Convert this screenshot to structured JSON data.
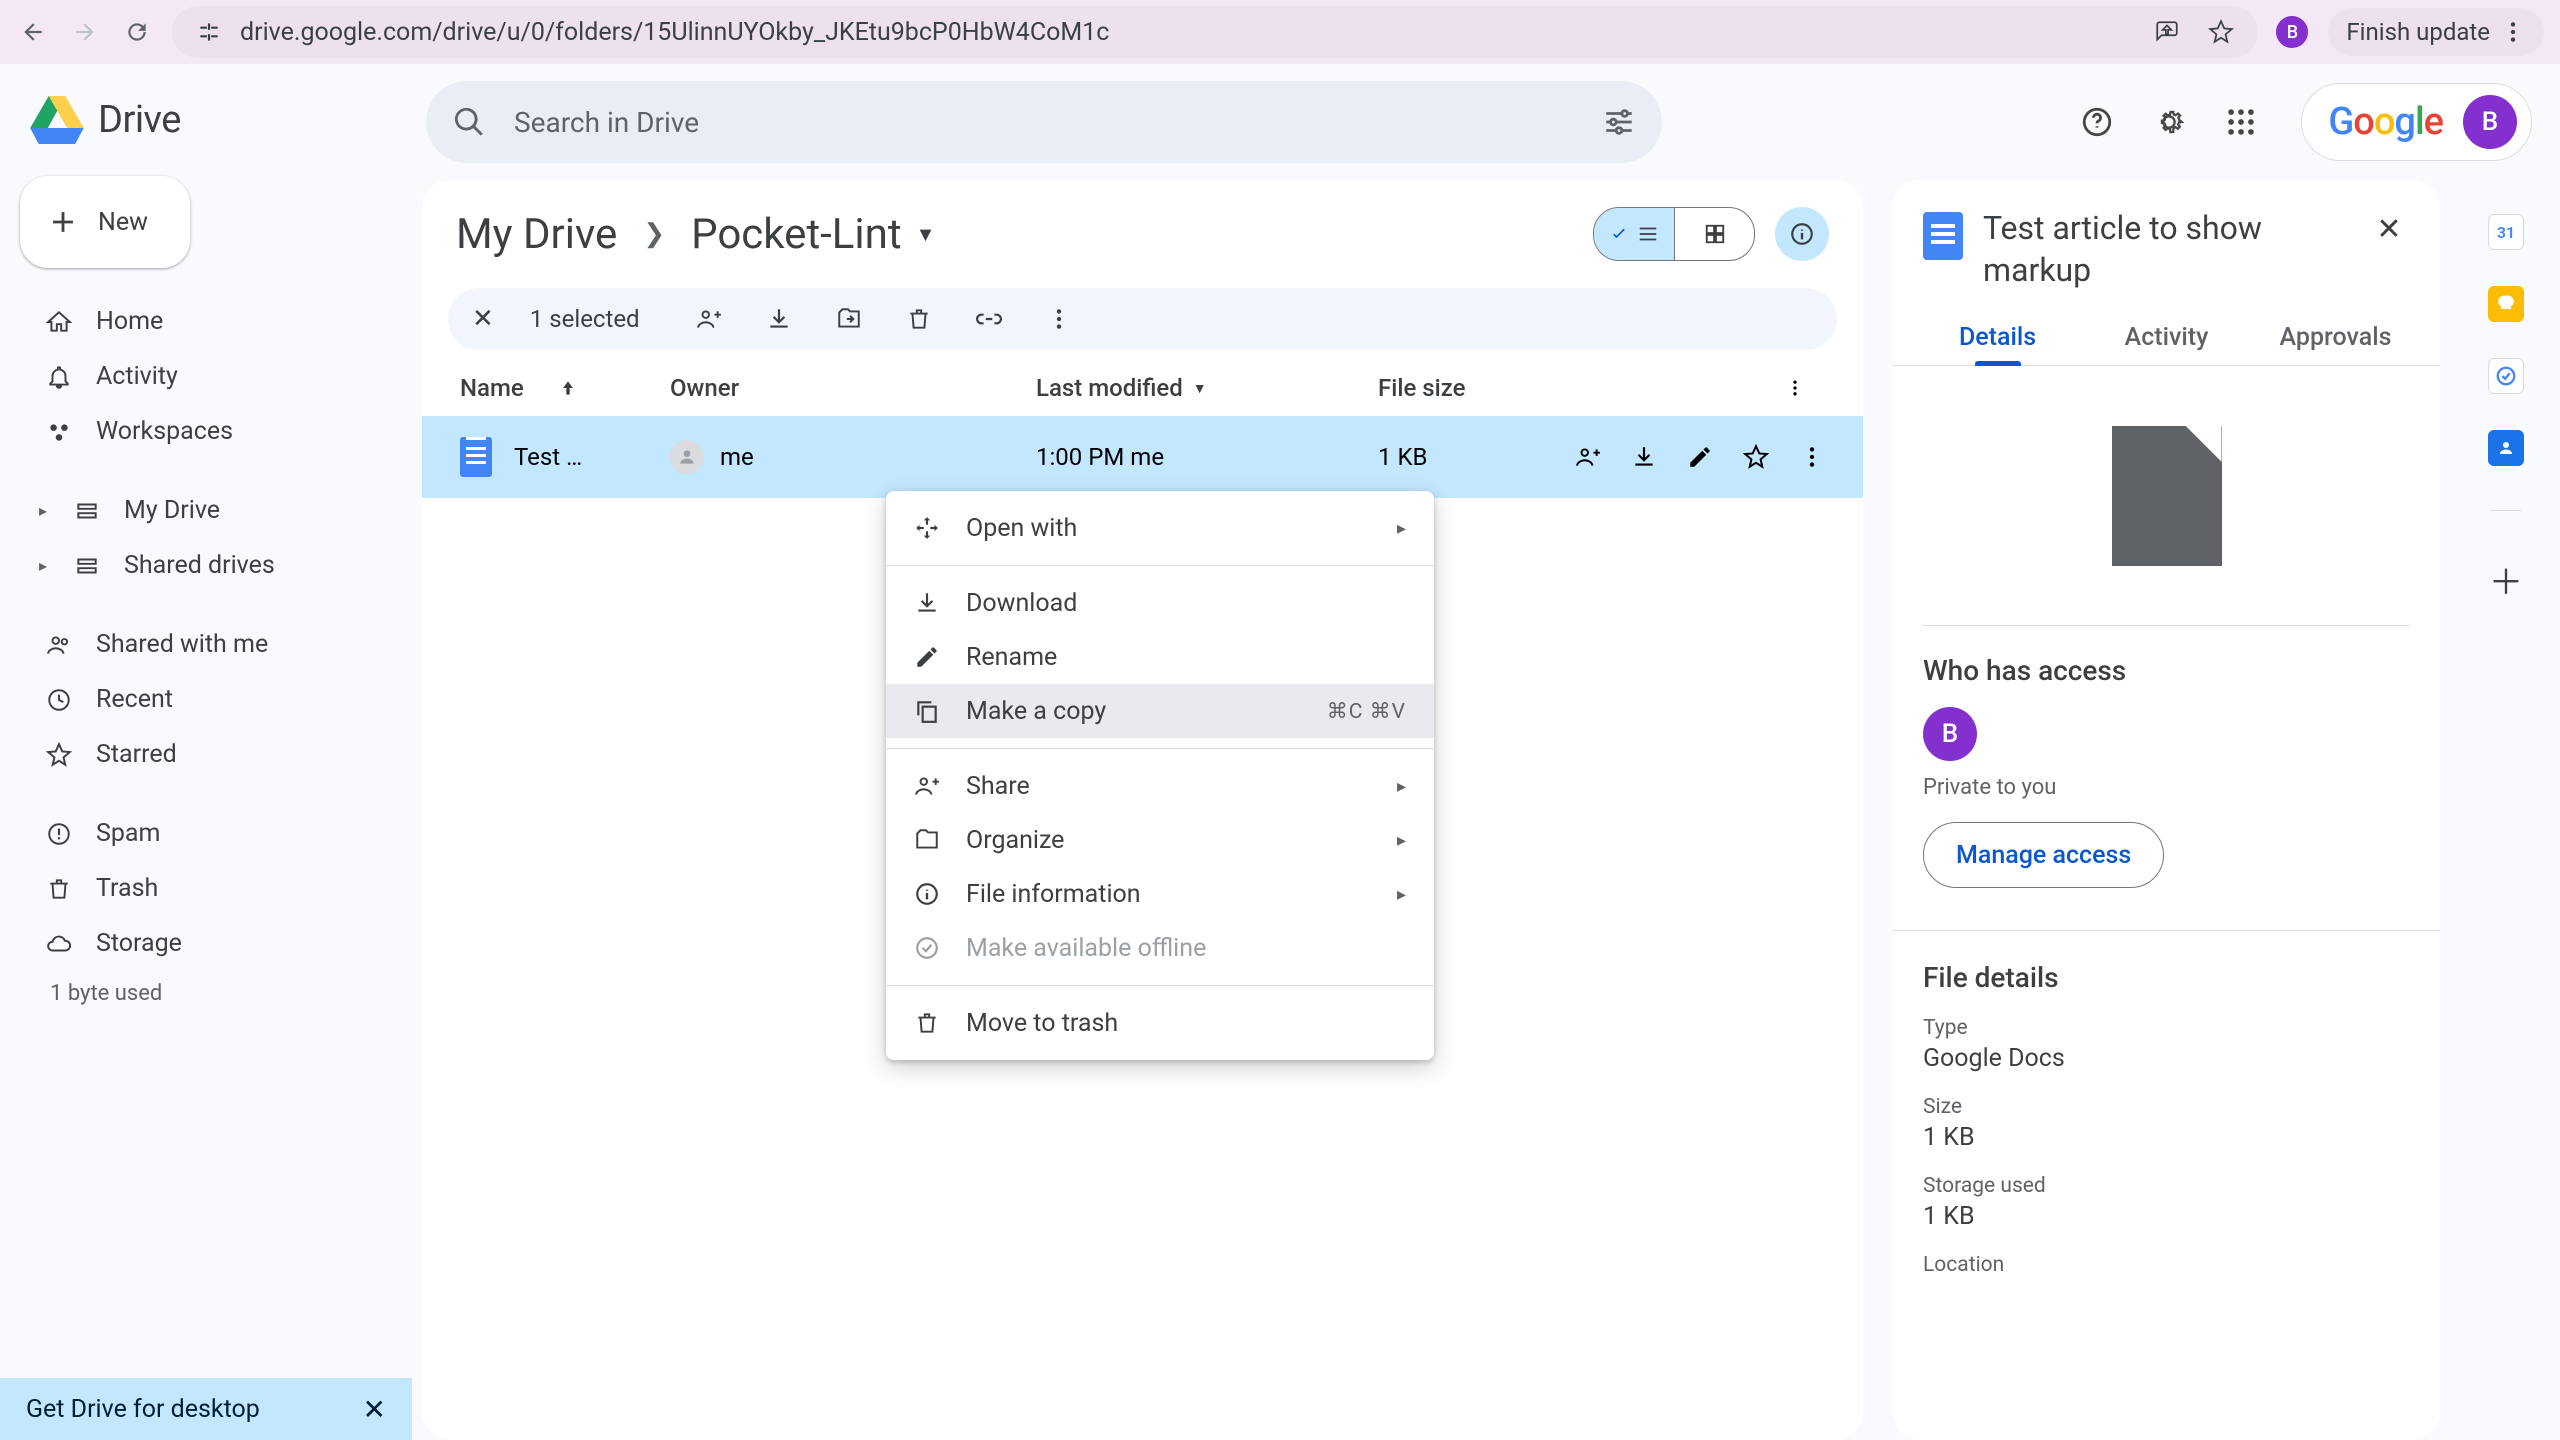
{
  "browser": {
    "url": "drive.google.com/drive/u/0/folders/15UlinnUYOkby_JKEtu9bcP0HbW4CoM1c",
    "avatar_letter": "B",
    "finish_update": "Finish update"
  },
  "header": {
    "app_name": "Drive",
    "search_placeholder": "Search in Drive",
    "google": "Google",
    "avatar_letter": "B"
  },
  "sidebar": {
    "new_label": "New",
    "items": {
      "home": "Home",
      "activity": "Activity",
      "workspaces": "Workspaces",
      "my_drive": "My Drive",
      "shared_drives": "Shared drives",
      "shared_with_me": "Shared with me",
      "recent": "Recent",
      "starred": "Starred",
      "spam": "Spam",
      "trash": "Trash",
      "storage": "Storage"
    },
    "storage_used": "1 byte used",
    "desktop_promo": "Get Drive for desktop"
  },
  "breadcrumb": {
    "root": "My Drive",
    "current": "Pocket-Lint"
  },
  "selection": {
    "count_label": "1 selected"
  },
  "columns": {
    "name": "Name",
    "owner": "Owner",
    "modified": "Last modified",
    "size": "File size"
  },
  "row": {
    "name": "Test …",
    "owner": "me",
    "modified": "1:00 PM me",
    "size": "1 KB"
  },
  "context_menu": {
    "open_with": "Open with",
    "download": "Download",
    "rename": "Rename",
    "make_copy": "Make a copy",
    "make_copy_shortcut": "⌘C ⌘V",
    "share": "Share",
    "organize": "Organize",
    "file_info": "File information",
    "offline": "Make available offline",
    "trash": "Move to trash"
  },
  "details": {
    "title": "Test article to show markup",
    "tabs": {
      "details": "Details",
      "activity": "Activity",
      "approvals": "Approvals"
    },
    "access_heading": "Who has access",
    "access_avatar": "B",
    "private": "Private to you",
    "manage": "Manage access",
    "file_details_heading": "File details",
    "type_label": "Type",
    "type_value": "Google Docs",
    "size_label": "Size",
    "size_value": "1 KB",
    "storage_label": "Storage used",
    "storage_value": "1 KB",
    "location_label": "Location"
  }
}
